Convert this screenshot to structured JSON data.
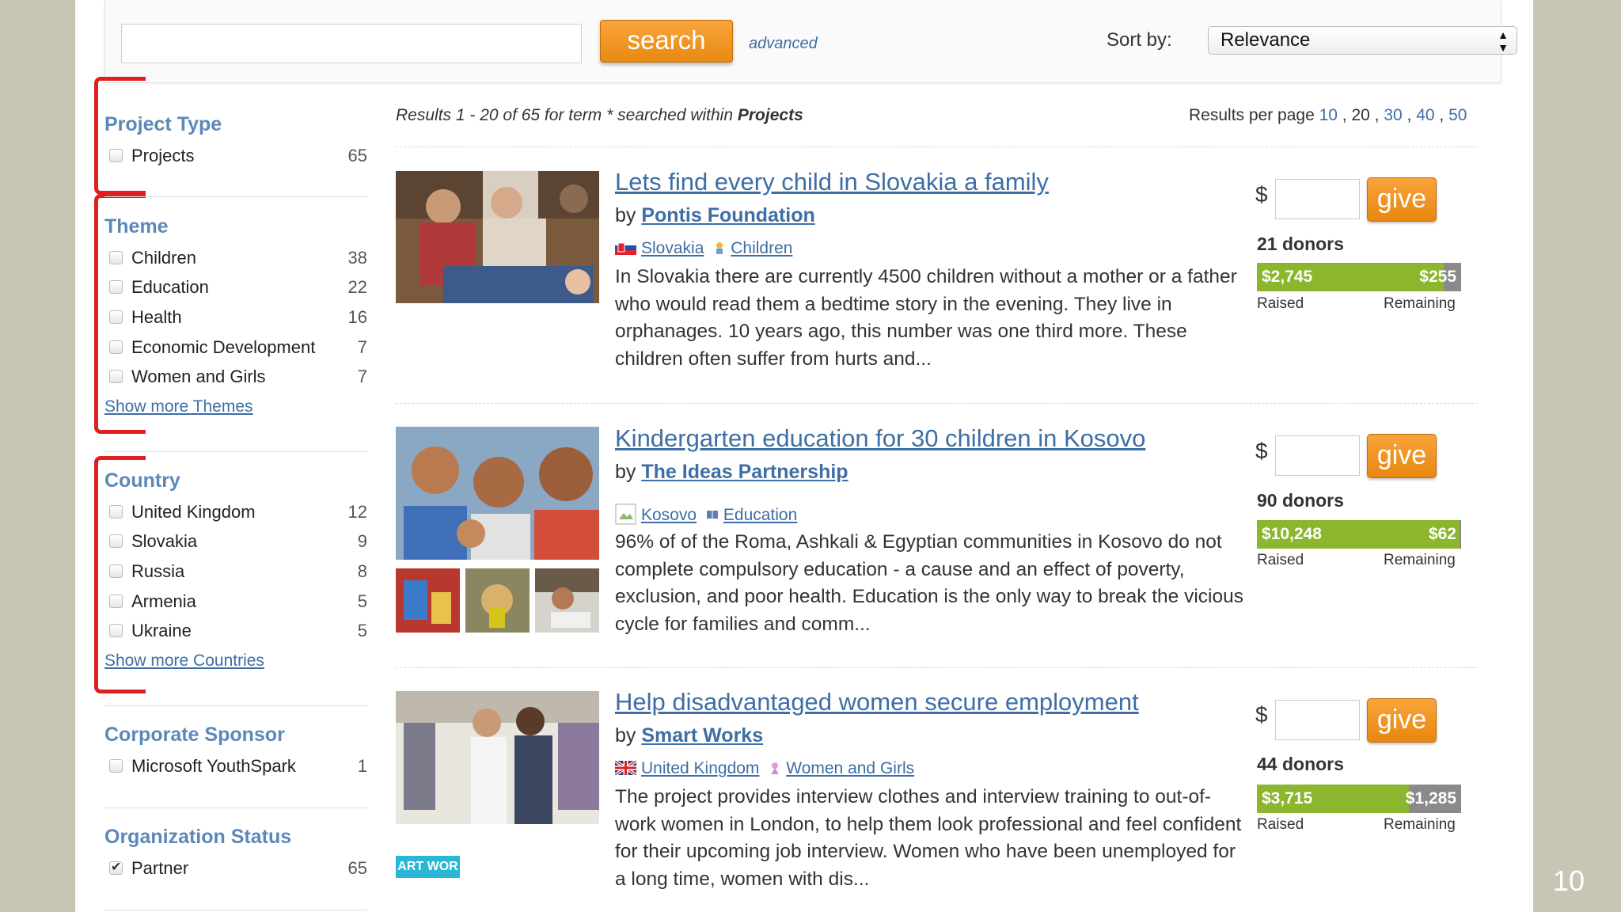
{
  "slide": {
    "page_number": "10"
  },
  "search": {
    "value": "",
    "button_label": "search",
    "advanced_label": "advanced",
    "sort_label": "Sort by:",
    "sort_value": "Relevance"
  },
  "sidebar": {
    "facets": [
      {
        "title": "Project Type",
        "items": [
          {
            "label": "Projects",
            "count": "65",
            "checked": false
          }
        ]
      },
      {
        "title": "Theme",
        "items": [
          {
            "label": "Children",
            "count": "38"
          },
          {
            "label": "Education",
            "count": "22"
          },
          {
            "label": "Health",
            "count": "16"
          },
          {
            "label": "Economic Development",
            "count": "7"
          },
          {
            "label": "Women and Girls",
            "count": "7"
          }
        ],
        "show_more": "Show more Themes"
      },
      {
        "title": "Country",
        "items": [
          {
            "label": "United Kingdom",
            "count": "12"
          },
          {
            "label": "Slovakia",
            "count": "9"
          },
          {
            "label": "Russia",
            "count": "8"
          },
          {
            "label": "Armenia",
            "count": "5"
          },
          {
            "label": "Ukraine",
            "count": "5"
          }
        ],
        "show_more": "Show more Countries"
      },
      {
        "title": "Corporate Sponsor",
        "items": [
          {
            "label": "Microsoft YouthSpark",
            "count": "1"
          }
        ]
      },
      {
        "title": "Organization Status",
        "items": [
          {
            "label": "Partner",
            "count": "65",
            "checked": true
          }
        ]
      }
    ]
  },
  "results": {
    "summary_prefix": "Results 1 - 20 of 65 for term * searched within ",
    "summary_scope": "Projects",
    "per_page_label": "Results per page",
    "per_page_options": [
      "10",
      "20",
      "30",
      "40",
      "50"
    ],
    "per_page_current": "20"
  },
  "projects": [
    {
      "title": "Lets find every child in Slovakia a family",
      "by": "by",
      "org": "Pontis Foundation",
      "country": "Slovakia",
      "theme": "Children",
      "description": "In Slovakia there are currently 4500 children without a mother or a father who would read them a bedtime story in the evening. They live in orphanages. 10 years ago, this number was one third more. These children often suffer from hurts and...",
      "currency": "$",
      "give": "give",
      "donors": "21 donors",
      "raised": "$2,745",
      "remaining": "$255",
      "progress": 0.915,
      "raised_label": "Raised",
      "remaining_label": "Remaining"
    },
    {
      "title": "Kindergarten education for 30 children in Kosovo",
      "by": "by",
      "org": "The Ideas Partnership",
      "country": "Kosovo",
      "theme": "Education",
      "description": "96% of of the Roma, Ashkali & Egyptian communities in Kosovo do not complete compulsory education - a cause and an effect of poverty, exclusion, and poor health. Education is the only way to break the vicious cycle for families and comm...",
      "currency": "$",
      "give": "give",
      "donors": "90 donors",
      "raised": "$10,248",
      "remaining": "$62",
      "progress": 0.994,
      "raised_label": "Raised",
      "remaining_label": "Remaining"
    },
    {
      "title": "Help disadvantaged women secure employment",
      "by": "by",
      "org": "Smart Works",
      "country": "United Kingdom",
      "theme": "Women and Girls",
      "description": "The project provides interview clothes and interview training to out-of-work women in London, to help them look professional and feel confident for their upcoming job interview. Women who have been unemployed for a long time, women with dis...",
      "currency": "$",
      "give": "give",
      "donors": "44 donors",
      "raised": "$3,715",
      "remaining": "$1,285",
      "progress": 0.743,
      "raised_label": "Raised",
      "remaining_label": "Remaining",
      "badge": "ART WOR"
    }
  ]
}
